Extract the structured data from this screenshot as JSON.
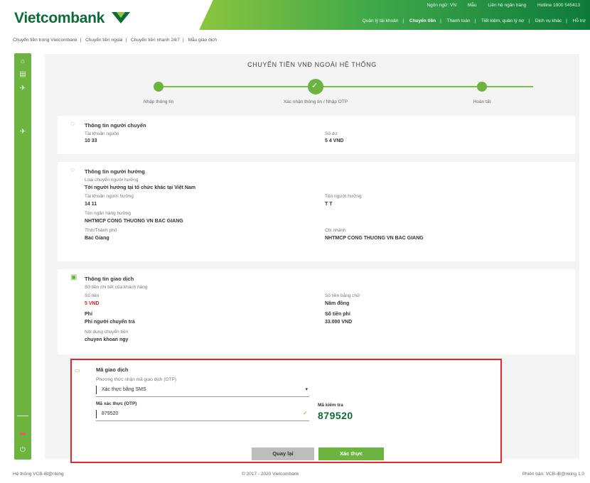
{
  "header": {
    "brand": "Vietcombank",
    "top_links": [
      "Ngôn ngữ: VN",
      "Mẫu",
      "Liên hệ ngân hàng",
      "Hotline 1900 545413"
    ],
    "nav": [
      "Quản lý tài khoản",
      "Chuyển tiền",
      "Thanh toán",
      "Tiết kiệm, quản lý nợ",
      "Dịch vụ khác",
      "Hỗ trợ"
    ],
    "nav_active_index": 1
  },
  "subnav": [
    "Chuyển tiền trong Vietcombank",
    "Chuyển tiền ngoài",
    "Chuyển tiền nhanh 24/7",
    "Mẫu giao dịch"
  ],
  "page": {
    "title": "CHUYỂN TIỀN VNĐ NGOÀI HỆ THỐNG"
  },
  "steps": [
    "Nhập thông tin",
    "Xác nhận thông tin / Nhập OTP",
    "Hoàn tất"
  ],
  "sender": {
    "title": "Thông tin người chuyển",
    "account_label": "Tài khoản nguồn",
    "account_value": "10 33",
    "balance_label": "Số dư",
    "balance_value": "5 4 VND"
  },
  "beneficiary": {
    "title": "Thông tin người hưởng",
    "type_label": "Loại chuyển người hưởng",
    "type_value": "Tới người hưởng tại tổ chức khác tại Việt Nam",
    "account_label": "Tài khoản người hưởng",
    "account_value": "14 11",
    "name_label": "Tên người hưởng",
    "name_value": "T T",
    "bank_label": "Tên ngân hàng hưởng",
    "bank_value": "NHTMCP CONG THUONG VN BAC GIANG",
    "province_label": "Tỉnh/Thành phố",
    "province_value": "Bac Giang",
    "branch_label": "Chi nhánh",
    "branch_value": "NHTMCP CONG THUONG VN BAC GIANG"
  },
  "transaction": {
    "title": "Thông tin giao dịch",
    "detail_label": "Số tiền chi tiết của khách hàng",
    "amount_label": "Số tiền",
    "amount_value": "5 VND",
    "words_label": "Số tiền bằng chữ",
    "words_value": "Năm đồng",
    "fee_type_label": "Phí",
    "fee_type_value": "Phí người chuyển trả",
    "fee_label": "Số tiền phí",
    "fee_value": "33.000 VND",
    "content_label": "Nội dung chuyển tiền",
    "content_value": "chuyen khoan ngy"
  },
  "otp": {
    "title": "Mã giao dịch",
    "method_label": "Phương thức nhận mã giao dịch (OTP)",
    "method_value": "Xác thực bằng SMS",
    "code_label": "Mã xác thực (OTP)",
    "code_value": "879520",
    "verify_label": "Mã kiểm tra",
    "verify_value": "879520"
  },
  "buttons": {
    "back": "Quay lại",
    "confirm": "Xác thực"
  },
  "footer": {
    "left": "Hệ thống VCB-iB@nking",
    "center": "© 2017 - 2020 Vietcombank",
    "right": "Phiên bản: VCB-iB@nking 1.0"
  },
  "colors": {
    "brand_green": "#0d6b37",
    "accent_green": "#6cb340",
    "otp_border": "#e02a2a"
  }
}
